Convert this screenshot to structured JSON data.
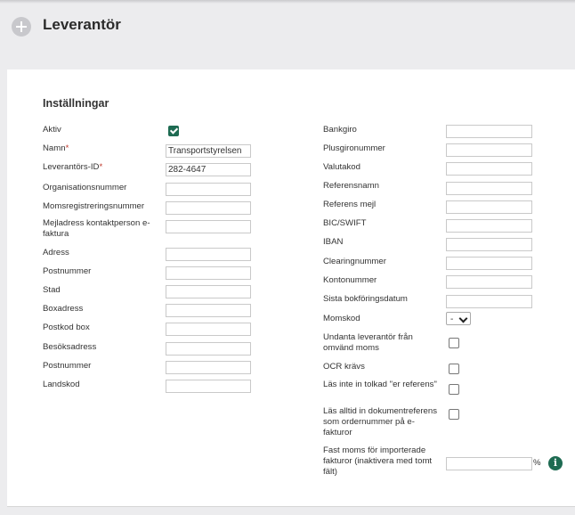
{
  "header": {
    "title": "Leverantör"
  },
  "section": {
    "title": "Inställningar"
  },
  "left_fields": [
    {
      "label": "Aktiv",
      "type": "checkbox",
      "checked": true
    },
    {
      "label": "Namn",
      "required": true,
      "type": "text",
      "value": "Transportstyrelsen"
    },
    {
      "label": "Leverantörs-ID",
      "required": true,
      "type": "text",
      "value": "282-4647"
    },
    {
      "label": "Organisationsnummer",
      "type": "text",
      "value": ""
    },
    {
      "label": "Momsregistreringsnummer",
      "type": "text",
      "value": ""
    },
    {
      "label": "Mejladress kontaktperson e-faktura",
      "type": "text",
      "value": ""
    },
    {
      "label": "Adress",
      "type": "text",
      "value": ""
    },
    {
      "label": "Postnummer",
      "type": "text",
      "value": ""
    },
    {
      "label": "Stad",
      "type": "text",
      "value": ""
    },
    {
      "label": "Boxadress",
      "type": "text",
      "value": ""
    },
    {
      "label": "Postkod box",
      "type": "text",
      "value": ""
    },
    {
      "label": "Besöksadress",
      "type": "text",
      "value": ""
    },
    {
      "label": "Postnummer",
      "type": "text",
      "value": ""
    },
    {
      "label": "Landskod",
      "type": "text",
      "value": ""
    }
  ],
  "right_fields": [
    {
      "label": "Bankgiro",
      "type": "text",
      "value": ""
    },
    {
      "label": "Plusgironummer",
      "type": "text",
      "value": ""
    },
    {
      "label": "Valutakod",
      "type": "text",
      "value": ""
    },
    {
      "label": "Referensnamn",
      "type": "text",
      "value": ""
    },
    {
      "label": "Referens mejl",
      "type": "text",
      "value": ""
    },
    {
      "label": "BIC/SWIFT",
      "type": "text",
      "value": ""
    },
    {
      "label": "IBAN",
      "type": "text",
      "value": ""
    },
    {
      "label": "Clearingnummer",
      "type": "text",
      "value": ""
    },
    {
      "label": "Kontonummer",
      "type": "text",
      "value": ""
    },
    {
      "label": "Sista bokföringsdatum",
      "type": "text",
      "value": ""
    },
    {
      "label": "Momskod",
      "type": "select",
      "value": "-"
    },
    {
      "label": "Undanta leverantör från omvänd moms",
      "type": "checkbox",
      "checked": false
    },
    {
      "label": "OCR krävs",
      "type": "checkbox",
      "checked": false
    },
    {
      "label": "Läs inte in tolkad \"er referens\"",
      "type": "checkbox",
      "checked": false
    },
    {
      "label": "Läs alltid in dokumentreferens som ordernummer på e-fakturor",
      "type": "checkbox",
      "checked": false
    },
    {
      "label": "Fast moms för importerade fakturor (inaktivera med tomt fält)",
      "type": "percent",
      "value": "",
      "unit": "%"
    }
  ],
  "colors": {
    "accent": "#1e6b52",
    "required": "#c0392b",
    "background": "#ececee"
  }
}
